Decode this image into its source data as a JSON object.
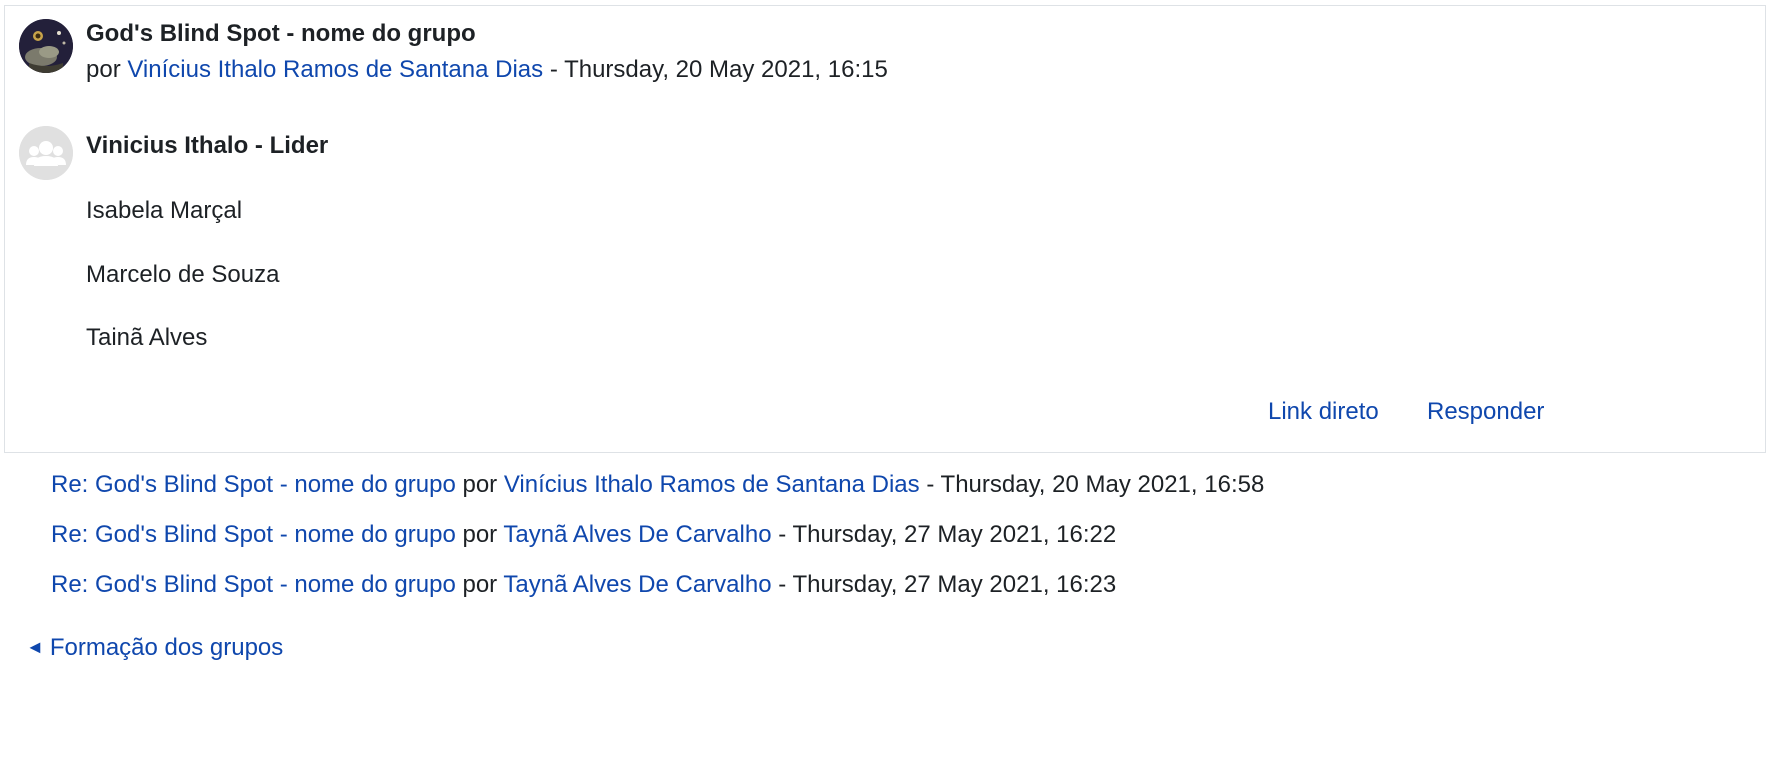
{
  "post": {
    "subject": "God's Blind Spot - nome do grupo",
    "by_prefix": "por",
    "author": "Vinícius Ithalo Ramos de Santana Dias",
    "separator": "-",
    "date": "Thursday, 20 May 2021, 16:15",
    "avatar_icon": "user-photo-icon"
  },
  "content": {
    "heading": "Vinicius Ithalo - Lider",
    "heading_avatar_icon": "group-icon",
    "members": [
      "Isabela Marçal",
      "Marcelo de Souza",
      "Tainã Alves"
    ]
  },
  "commands": {
    "permalink": "Link direto",
    "reply": "Responder"
  },
  "replies": [
    {
      "subject": "Re: God's Blind Spot - nome do grupo",
      "by_prefix": "por",
      "author": "Vinícius Ithalo Ramos de Santana Dias",
      "separator": "-",
      "date": "Thursday, 20 May 2021, 16:58"
    },
    {
      "subject": "Re: God's Blind Spot - nome do grupo",
      "by_prefix": "por",
      "author": "Taynã Alves De Carvalho",
      "separator": "-",
      "date": "Thursday, 27 May 2021, 16:22"
    },
    {
      "subject": "Re: God's Blind Spot - nome do grupo",
      "by_prefix": "por",
      "author": "Taynã Alves De Carvalho",
      "separator": "-",
      "date": "Thursday, 27 May 2021, 16:23"
    }
  ],
  "navigation": {
    "back_arrow": "◄",
    "back_label": "Formação dos grupos"
  },
  "colors": {
    "link": "#0f47ad",
    "text": "#1d2125",
    "border": "#dee2e6",
    "default_avatar": "#e0e0e0"
  }
}
